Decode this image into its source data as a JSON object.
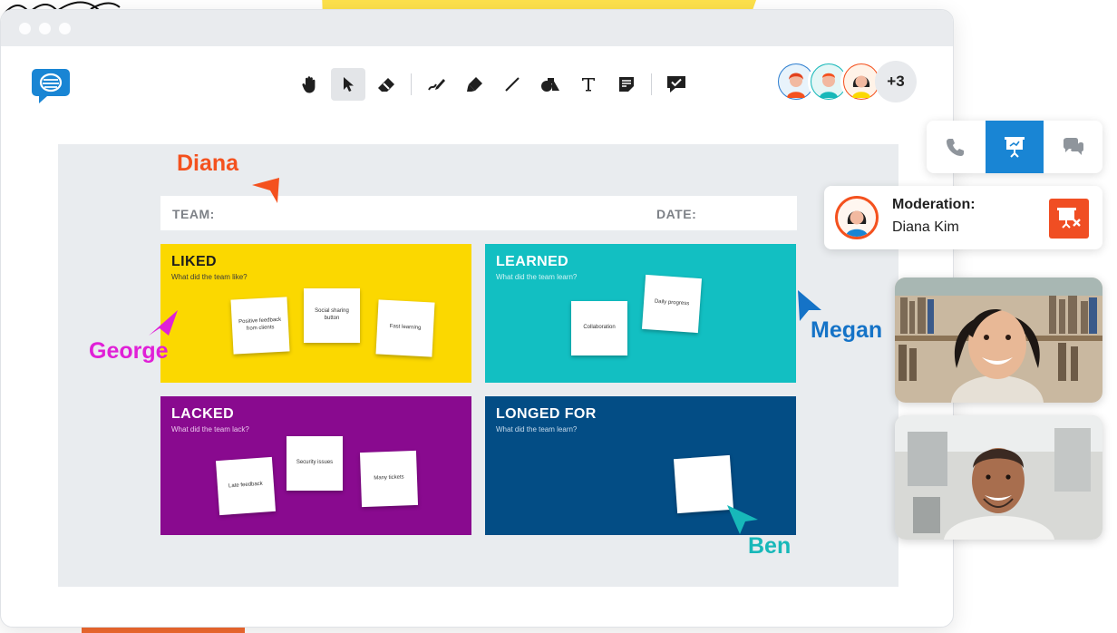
{
  "board": {
    "team_label": "TEAM:",
    "date_label": "DATE:",
    "quadrants": [
      {
        "title": "LIKED",
        "subtitle": "What did the team like?",
        "color": "#fbd800",
        "notes": [
          "Positive feedback from clients",
          "Social sharing button",
          "Fast learning"
        ]
      },
      {
        "title": "LEARNED",
        "subtitle": "What did the team learn?",
        "color": "#12bfc2",
        "notes": [
          "Collaboration",
          "Daily progress"
        ]
      },
      {
        "title": "LACKED",
        "subtitle": "What did the team lack?",
        "color": "#890a8f",
        "notes": [
          "Late feedback",
          "Security issues",
          "Many tickets"
        ]
      },
      {
        "title": "LONGED FOR",
        "subtitle": "What did the team learn?",
        "color": "#034d85",
        "notes": [
          ""
        ]
      }
    ]
  },
  "cursors": {
    "diana": {
      "name": "Diana",
      "color": "#f4511e"
    },
    "george": {
      "name": "George",
      "color": "#e020d7"
    },
    "megan": {
      "name": "Megan",
      "color": "#1573c7"
    },
    "ben": {
      "name": "Ben",
      "color": "#17b8b9"
    }
  },
  "participants": {
    "extra_count": "+3"
  },
  "toolbar": {
    "tools": [
      "hand-icon",
      "pointer-icon",
      "eraser-icon",
      "pen-icon",
      "highlighter-icon",
      "line-icon",
      "shapes-icon",
      "text-icon",
      "sticky-note-icon",
      "feedback-icon"
    ],
    "active_tool": "pointer-icon"
  },
  "moderation": {
    "title": "Moderation:",
    "name": "Diana Kim"
  },
  "modes": {
    "active": "presentation",
    "accent": "#1985d4"
  }
}
